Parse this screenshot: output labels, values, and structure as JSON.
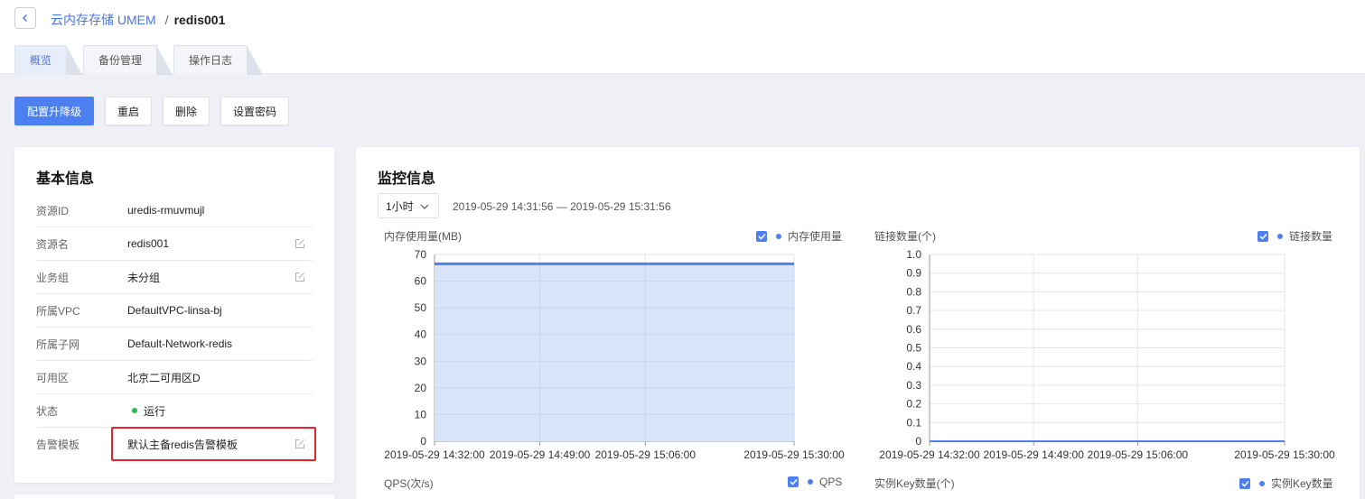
{
  "header": {
    "breadcrumb_parent": "云内存存储 UMEM",
    "breadcrumb_separator": "/",
    "breadcrumb_current": "redis001"
  },
  "tabs": [
    {
      "label": "概览",
      "active": true
    },
    {
      "label": "备份管理",
      "active": false
    },
    {
      "label": "操作日志",
      "active": false
    }
  ],
  "actions": {
    "upgrade": "配置升降级",
    "restart": "重启",
    "delete": "删除",
    "set_password": "设置密码"
  },
  "basic_info": {
    "title": "基本信息",
    "rows": [
      {
        "label": "资源ID",
        "value": "uredis-rmuvmujl",
        "editable": false
      },
      {
        "label": "资源名",
        "value": "redis001",
        "editable": true
      },
      {
        "label": "业务组",
        "value": "未分组",
        "editable": true
      },
      {
        "label": "所属VPC",
        "value": "DefaultVPC-linsa-bj",
        "editable": false
      },
      {
        "label": "所属子网",
        "value": "Default-Network-redis",
        "editable": false
      },
      {
        "label": "可用区",
        "value": "北京二可用区D",
        "editable": false
      },
      {
        "label": "状态",
        "value": "运行",
        "editable": false
      },
      {
        "label": "告警模板",
        "value": "默认主备redis告警模板",
        "editable": true
      }
    ]
  },
  "monitor": {
    "title": "监控信息",
    "range_select": "1小时",
    "time_range": "2019-05-29 14:31:56 — 2019-05-29 15:31:56"
  },
  "colors": {
    "primary": "#4c80f0",
    "status_running": "#2bbd4f",
    "highlight": "#e0262a",
    "area_fill": "#d6e4f8"
  },
  "chart_data": [
    {
      "type": "area",
      "title": "内存使用量(MB)",
      "legend": "内存使用量",
      "x_ticks": [
        "2019-05-29 14:32:00",
        "2019-05-29 14:49:00",
        "2019-05-29 15:06:00",
        "2019-05-29 15:30:00"
      ],
      "ylim": [
        0,
        70
      ],
      "y_ticks": [
        0,
        10,
        20,
        30,
        40,
        50,
        60,
        70
      ],
      "series": [
        {
          "name": "内存使用量",
          "x": [
            "2019-05-29 14:32:00",
            "2019-05-29 15:30:00"
          ],
          "values": [
            66.5,
            66.5
          ]
        }
      ]
    },
    {
      "type": "line",
      "title": "链接数量(个)",
      "legend": "链接数量",
      "x_ticks": [
        "2019-05-29 14:32:00",
        "2019-05-29 14:49:00",
        "2019-05-29 15:06:00",
        "2019-05-29 15:30:00"
      ],
      "ylim": [
        0,
        1.0
      ],
      "y_ticks": [
        "0",
        "0.1",
        "0.2",
        "0.3",
        "0.4",
        "0.5",
        "0.6",
        "0.7",
        "0.8",
        "0.9",
        "1.0"
      ],
      "series": [
        {
          "name": "链接数量",
          "x": [
            "2019-05-29 14:32:00",
            "2019-05-29 15:30:00"
          ],
          "values": [
            0,
            0
          ]
        }
      ]
    },
    {
      "type": "line",
      "title": "QPS(次/s)",
      "legend": "QPS",
      "series": [
        {
          "name": "QPS",
          "values": []
        }
      ]
    },
    {
      "type": "line",
      "title": "实例Key数量(个)",
      "legend": "实例Key数量",
      "series": [
        {
          "name": "实例Key数量",
          "values": []
        }
      ]
    }
  ]
}
